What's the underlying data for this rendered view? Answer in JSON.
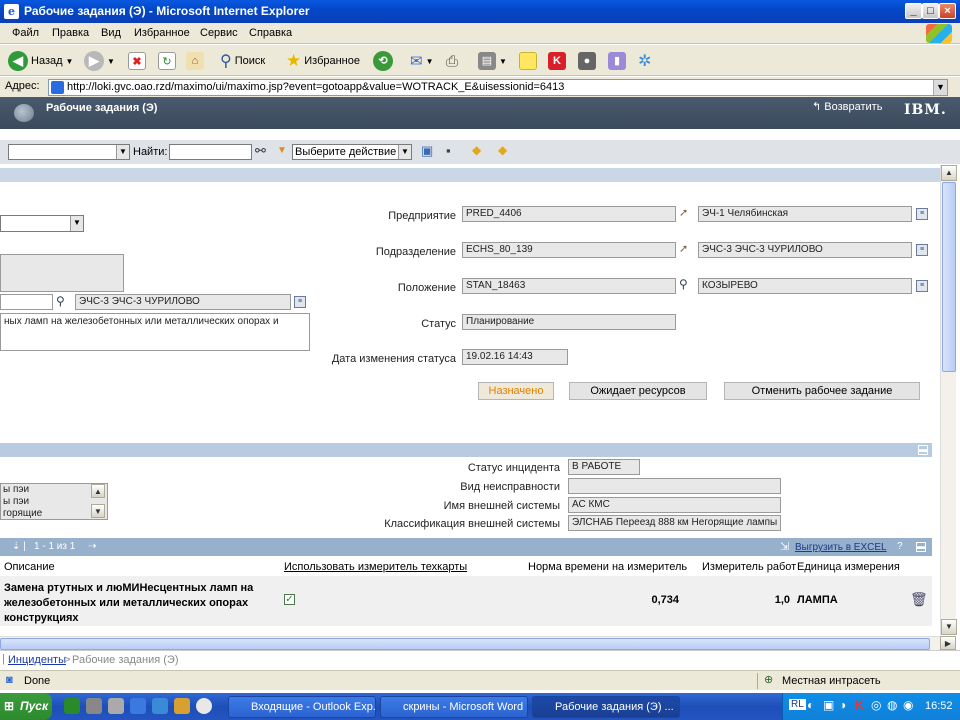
{
  "window": {
    "title": "Рабочие задания (Э) - Microsoft Internet Explorer",
    "controls": [
      "_",
      "□",
      "×"
    ]
  },
  "menu": [
    "Файл",
    "Правка",
    "Вид",
    "Избранное",
    "Сервис",
    "Справка"
  ],
  "toolbar": {
    "back": "Назад",
    "search": "Поиск",
    "favorites": "Избранное"
  },
  "address": {
    "label": "Адрес:",
    "url": "http://loki.gvc.oao.rzd/maximo/ui/maximo.jsp?event=gotoapp&value=WOTRACK_E&uisessionid=6413"
  },
  "app": {
    "title": "Рабочие задания (Э)",
    "back": "Возвратить",
    "brand": "IBM."
  },
  "apptoolbar": {
    "find_label": "Найти:",
    "action_select": "Выберите действие"
  },
  "left": {
    "loc_desc": "ЭЧС-3 ЭЧС-3 ЧУРИЛОВО",
    "description": "ных ламп на железобетонных или металлических опорах и"
  },
  "form": {
    "enterprise_label": "Предприятие",
    "enterprise_value": "PRED_4406",
    "enterprise_desc": "ЭЧ-1 Челябинская",
    "division_label": "Подразделение",
    "division_value": "ECHS_80_139",
    "division_desc": "ЭЧС-3 ЭЧС-3 ЧУРИЛОВО",
    "position_label": "Положение",
    "position_value": "STAN_18463",
    "position_desc": "КОЗЫРЕВО",
    "status_label": "Статус",
    "status_value": "Планирование",
    "status_date_label": "Дата изменения статуса",
    "status_date_value": "19.02.16 14:43"
  },
  "buttons": {
    "assigned": "Назначено",
    "waiting": "Ожидает ресурсов",
    "cancel": "Отменить рабочее задание"
  },
  "incident": {
    "status_label": "Статус инцидента",
    "status_value": "В РАБОТЕ",
    "fault_label": "Вид неисправности",
    "fault_value": "",
    "ext_name_label": "Имя внешней системы",
    "ext_name_value": "АС КМС",
    "ext_class_label": "Классификация внешней системы",
    "ext_class_value": "ЭЛСНАБ Переезд 888 км  Негорящие лампы",
    "list_items": [
      "ы пэи",
      "ы пэи",
      "горящие"
    ]
  },
  "grid": {
    "pager": "1 - 1 из 1",
    "export": "Выгрузить в EXCEL",
    "help": "?",
    "columns": [
      "Описание",
      "Использовать измеритель техкарты",
      "Норма времени на измеритель",
      "Измеритель работ",
      "Единица измерения"
    ],
    "row": {
      "description": "Замена ртутных и люМИНесцентных ламп на железобетонных или металлических опорах конструкциях",
      "desc_line1": "Замена ртутных и люМИНесцентных ламп на",
      "desc_line2": "железобетонных или металлических опорах",
      "desc_line3": "конструкциях",
      "use_meter": true,
      "norm": "0,734",
      "meter": "1,0",
      "unit": "ЛАМПА"
    }
  },
  "breadcrumb": {
    "link": "Инциденты",
    "sep": ">",
    "current": "Рабочие задания (Э)"
  },
  "status": {
    "text": "Done",
    "zone": "Местная интрасеть"
  },
  "taskbar": {
    "start": "Пуск",
    "tasks": [
      "Входящие - Outlook Exp...",
      "скрины - Microsoft Word",
      "Рабочие задания (Э) ..."
    ],
    "time": "16:52"
  }
}
